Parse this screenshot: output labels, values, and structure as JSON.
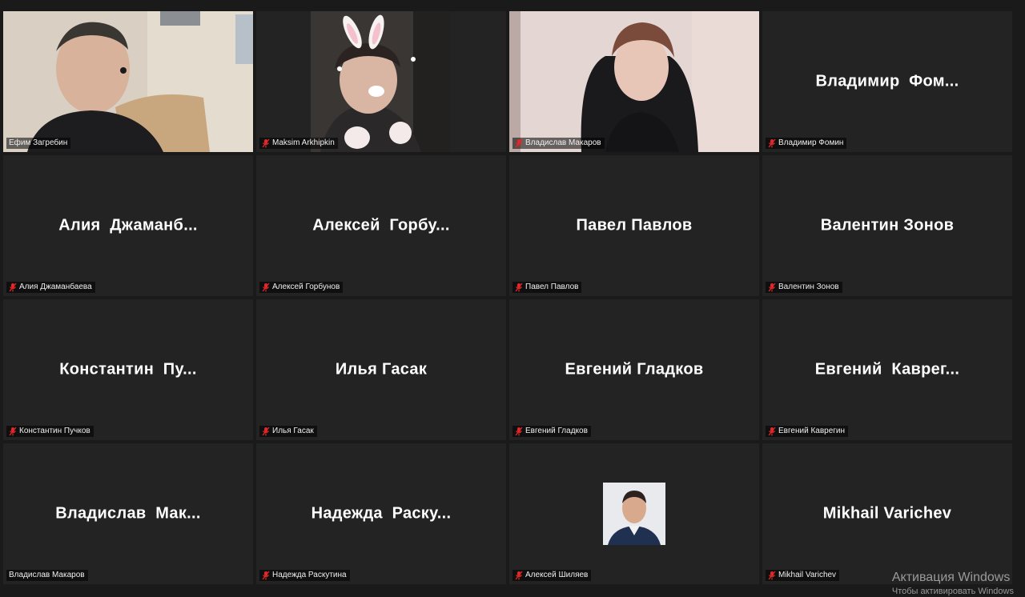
{
  "participants": [
    {
      "display_name": "",
      "label": "Ефим Загребин",
      "muted": false,
      "video": true,
      "speaking": true
    },
    {
      "display_name": "",
      "label": "Maksim Arkhipkin",
      "muted": true,
      "video": true
    },
    {
      "display_name": "",
      "label": "Владислав Макаров",
      "muted": true,
      "video": true
    },
    {
      "display_name": "Владимир  Фом...",
      "label": "Владимир Фомин",
      "muted": true,
      "video": false
    },
    {
      "display_name": "Алия  Джаманб...",
      "label": "Алия Джаманбаева",
      "muted": true,
      "video": false
    },
    {
      "display_name": "Алексей  Горбу...",
      "label": "Алексей Горбунов",
      "muted": true,
      "video": false
    },
    {
      "display_name": "Павел Павлов",
      "label": "Павел Павлов",
      "muted": true,
      "video": false
    },
    {
      "display_name": "Валентин Зонов",
      "label": "Валентин Зонов",
      "muted": true,
      "video": false
    },
    {
      "display_name": "Константин  Пу...",
      "label": "Константин Пучков",
      "muted": true,
      "video": false
    },
    {
      "display_name": "Илья Гасак",
      "label": "Илья Гасак",
      "muted": true,
      "video": false
    },
    {
      "display_name": "Евгений Гладков",
      "label": "Евгений Гладков",
      "muted": true,
      "video": false
    },
    {
      "display_name": "Евгений  Кавpег...",
      "label": "Евгений Кавpегин",
      "muted": true,
      "video": false
    },
    {
      "display_name": "Владислав  Мак...",
      "label": "Владислав Макаров",
      "muted": false,
      "video": false
    },
    {
      "display_name": "Надежда  Раску...",
      "label": "Надежда Раскутина",
      "muted": true,
      "video": false
    },
    {
      "display_name": "",
      "label": "Алексей Шиляев",
      "muted": true,
      "video": false,
      "avatar_photo": true
    },
    {
      "display_name": "Mikhail Varichev",
      "label": "Mikhail Varichev",
      "muted": true,
      "video": false
    }
  ],
  "colors": {
    "active_speaker_border": "#d4e88a",
    "muted_icon": "#e02828",
    "tile_bg": "#232323"
  },
  "watermark": {
    "line1": "Активация Windows",
    "line2": "Чтобы активировать Windows"
  }
}
